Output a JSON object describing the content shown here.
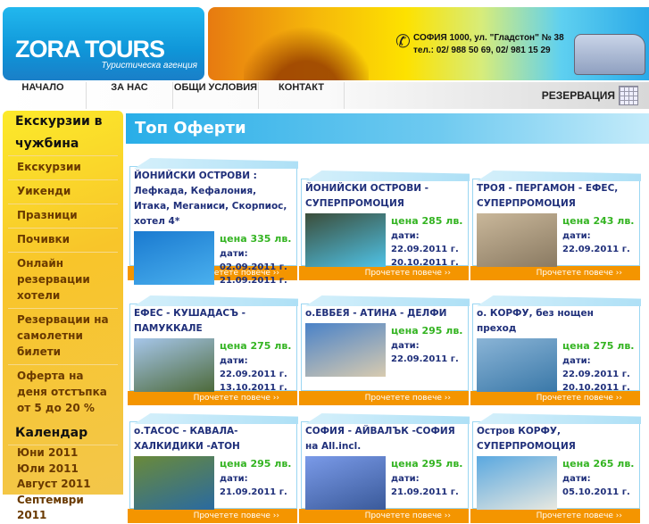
{
  "header": {
    "brand": "ZORA TOURS",
    "tagline": "Туристическа агенция",
    "address": "СОФИЯ 1000, ул. \"Гладстон\" № 38",
    "phones": "тел.: 02/ 988 50 69, 02/ 981 15 29"
  },
  "nav": {
    "items": [
      "НАЧАЛО",
      "ЗА НАС",
      "ОБЩИ УСЛОВИЯ",
      "КОНТАКТ"
    ],
    "reserve": "РЕЗЕРВАЦИЯ"
  },
  "sidebar": {
    "heading": "Екскурзии в чужбина",
    "items": [
      "Екскурзии",
      "Уикенди",
      "Празници",
      "Почивки",
      "Онлайн резервации хотели",
      "Резервации на самолетни билети",
      "Оферта на деня отстъпка от 5 до 20 %"
    ],
    "calendar_heading": "Календар",
    "months": [
      "Юни 2011",
      "Юли 2011",
      "Август 2011",
      "Септември 2011"
    ]
  },
  "main": {
    "title": "Топ Оферти",
    "more_label": "Прочетете повече ››",
    "dates_label": "дати:",
    "offers": [
      {
        "title": "ЙОНИЙСКИ ОСТРОВИ : Лефкада, Кефалония, Итака, Меганиси, Скорпиос, хотел 4*",
        "price": "цена 335 лв.",
        "dates": [
          "02.09.2011 г.",
          "21.09.2011 г."
        ],
        "colors": [
          "#1a7ad0",
          "#4ab0ee"
        ]
      },
      {
        "title": "ЙОНИЙСКИ ОСТРОВИ - СУПЕРПРОМОЦИЯ",
        "price": "цена 285 лв.",
        "dates": [
          "22.09.2011 г.",
          "20.10.2011 г."
        ],
        "colors": [
          "#3b4d3a",
          "#4fc2e6"
        ]
      },
      {
        "title": "ТРОЯ - ПЕРГАМОН - ЕФЕС, СУПЕРПРОМОЦИЯ",
        "price": "цена 243 лв.",
        "dates": [
          "22.09.2011 г."
        ],
        "colors": [
          "#c9b79a",
          "#8a7a62"
        ]
      },
      {
        "title": "ЕФЕС - КУШАДАСЪ - ПАМУККАЛЕ",
        "price": "цена 275 лв.",
        "dates": [
          "22.09.2011 г.",
          "13.10.2011 г."
        ],
        "colors": [
          "#a6c6ea",
          "#4d6a3a"
        ]
      },
      {
        "title": "о.ЕВБЕЯ - АТИНА - ДЕЛФИ",
        "price": "цена 295 лв.",
        "dates": [
          "22.09.2011 г."
        ],
        "colors": [
          "#4a82c8",
          "#d8cbb0"
        ]
      },
      {
        "title": "о. КОРФУ, без нощен преход",
        "price": "цена 275 лв.",
        "dates": [
          "22.09.2011 г.",
          "20.10.2011 г."
        ],
        "colors": [
          "#8ab4d6",
          "#3a78a8"
        ]
      },
      {
        "title": "о.ТАСОС - КАВАЛА- ХАЛКИДИКИ -АТОН",
        "price": "цена 295 лв.",
        "dates": [
          "21.09.2011 г."
        ],
        "colors": [
          "#6a8a3a",
          "#2a6aa0"
        ]
      },
      {
        "title": "СОФИЯ - АЙВАЛЪК -СОФИЯ на All.incl.",
        "price": "цена 295 лв.",
        "dates": [
          "21.09.2011 г."
        ],
        "colors": [
          "#7a9ae8",
          "#3a5a9a"
        ]
      },
      {
        "title": "Остров КОРФУ, СУПЕРПРОМОЦИЯ",
        "price": "цена 265 лв.",
        "dates": [
          "05.10.2011 г."
        ],
        "colors": [
          "#5aa8e0",
          "#e8e8e0"
        ]
      }
    ]
  }
}
